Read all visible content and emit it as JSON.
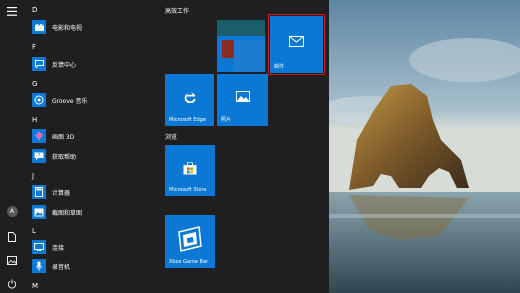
{
  "desktop": {
    "sky": "#7f9fb6",
    "sea": "#3e5561"
  },
  "rail": {
    "icons": [
      "hamburger-menu-icon",
      "user-avatar-icon",
      "documents-icon",
      "pictures-icon",
      "power-icon"
    ],
    "avatar_letter": "A"
  },
  "apps": {
    "section_d": "D",
    "film": "电影和电视",
    "section_f": "F",
    "feedback": "反馈中心",
    "section_g": "G",
    "groove": "Groove 音乐",
    "section_h": "H",
    "paint3d": "画图 3D",
    "gethelp": "获取帮助",
    "section_j": "J",
    "calculator": "计算器",
    "snip": "截图和草图",
    "section_l": "L",
    "connect": "连接",
    "recorder": "录音机",
    "section_m": "M"
  },
  "groups": {
    "work": "高效工作",
    "browse": "浏览"
  },
  "tiles": {
    "mail": "邮件",
    "edge": "Microsoft Edge",
    "photos": "照片",
    "store": "Microsoft Store",
    "xbox": "Xbox Game Bar"
  },
  "colors": {
    "accent": "#0a78d4",
    "highlight": "#d3191c",
    "menu_bg": "#1f1f1f"
  }
}
